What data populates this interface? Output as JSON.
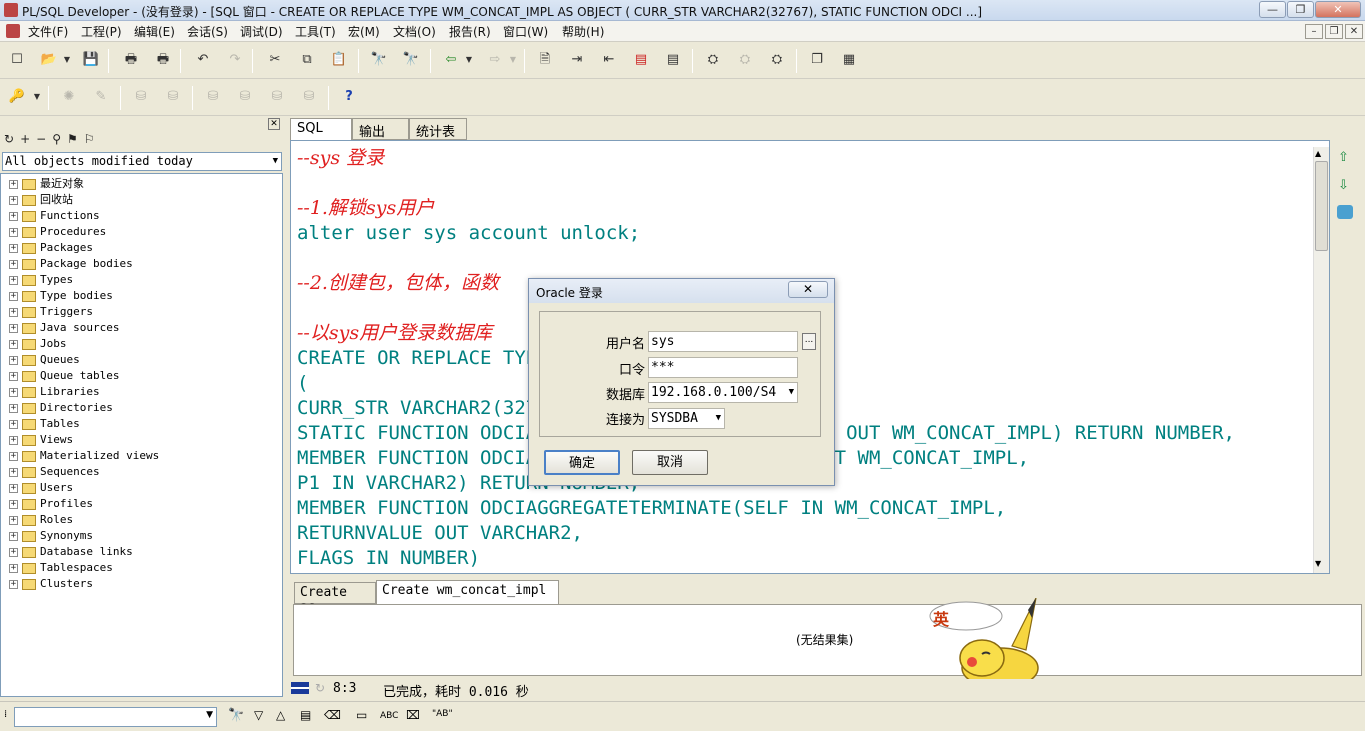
{
  "window": {
    "title": "PL/SQL Developer - (没有登录) - [SQL 窗口 - CREATE OR REPLACE TYPE WM_CONCAT_IMPL AS OBJECT ( CURR_STR VARCHAR2(32767), STATIC FUNCTION ODCI ...]",
    "minimize": "—",
    "restore": "❐",
    "close": "✕"
  },
  "menu": [
    "文件(F)",
    "工程(P)",
    "编辑(E)",
    "会话(S)",
    "调试(D)",
    "工具(T)",
    "宏(M)",
    "文档(O)",
    "报告(R)",
    "窗口(W)",
    "帮助(H)"
  ],
  "mdi": {
    "minimize": "–",
    "restore": "❐",
    "close": "✕"
  },
  "left_panel": {
    "filter": "All objects modified today",
    "tree": [
      "最近对象",
      "回收站",
      "Functions",
      "Procedures",
      "Packages",
      "Package bodies",
      "Types",
      "Type bodies",
      "Triggers",
      "Java sources",
      "Jobs",
      "Queues",
      "Queue tables",
      "Libraries",
      "Directories",
      "Tables",
      "Views",
      "Materialized views",
      "Sequences",
      "Users",
      "Profiles",
      "Roles",
      "Synonyms",
      "Database links",
      "Tablespaces",
      "Clusters"
    ]
  },
  "editor_tabs": [
    "SQL",
    "输出",
    "统计表"
  ],
  "code_lines": [
    {
      "text": "--sys 登录",
      "type": "comment"
    },
    {
      "text": "",
      "type": "blank"
    },
    {
      "text": "--1.解锁sys用户",
      "type": "comment"
    },
    {
      "text": "alter user sys account unlock;",
      "type": "code"
    },
    {
      "text": "",
      "type": "blank"
    },
    {
      "text": "--2.创建包，包体，函数",
      "type": "comment"
    },
    {
      "text": "",
      "type": "blank"
    },
    {
      "text": "--以sys用户登录数据库",
      "type": "comment"
    },
    {
      "text": "CREATE OR REPLACE TYPE WM_CONCAT_IMPL AS OBJECT",
      "type": "code"
    },
    {
      "text": "(",
      "type": "code"
    },
    {
      "text": "CURR_STR VARCHAR2(32767),",
      "type": "code"
    },
    {
      "text": "STATIC FUNCTION ODCIAGGREGATEINITIALIZE(SCTX IN OUT WM_CONCAT_IMPL) RETURN NUMBER,",
      "type": "code"
    },
    {
      "text": "MEMBER FUNCTION ODCIAGGREGATEITERATE(SELF IN OUT WM_CONCAT_IMPL,",
      "type": "code"
    },
    {
      "text": "P1 IN VARCHAR2) RETURN NUMBER,",
      "type": "code"
    },
    {
      "text": "MEMBER FUNCTION ODCIAGGREGATETERMINATE(SELF IN WM_CONCAT_IMPL,",
      "type": "code"
    },
    {
      "text": "RETURNVALUE OUT VARCHAR2,",
      "type": "code"
    },
    {
      "text": "FLAGS IN NUMBER)",
      "type": "code"
    }
  ],
  "result_tabs": [
    "Create as",
    "Create wm_concat_impl"
  ],
  "result_text": "(无结果集)",
  "status": {
    "position": "8:3",
    "message": "已完成，耗时 0.016 秒"
  },
  "dialog": {
    "title": "Oracle 登录",
    "close": "✕",
    "username_label": "用户名",
    "username": "sys",
    "browse": "...",
    "password_label": "口令",
    "password": "***",
    "database_label": "数据库",
    "database": "192.168.0.100/S4",
    "connect_as_label": "连接为",
    "connect_as": "SYSDBA",
    "ok": "确定",
    "cancel": "取消"
  },
  "mascot": {
    "badge": "英"
  },
  "bottom_toolbar": {
    "abc": "ABC",
    "ab_quote": "\"AB\""
  }
}
